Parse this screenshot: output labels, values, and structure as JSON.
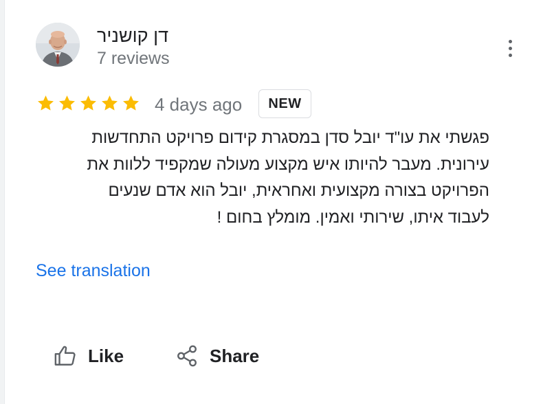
{
  "reviewer": {
    "name": "דן קושניר",
    "reviews_count": "7 reviews"
  },
  "review": {
    "rating": 5,
    "rating_max": 5,
    "star_color": "#fbbc04",
    "date": "4 days ago",
    "badge": "NEW",
    "lines": [
      "פגשתי את עו\"ד יובל סדן במסגרת קידום פרויקט התחדשות",
      "עירונית. מעבר להיותו איש מקצוע מעולה שמקפיד ללוות את",
      "הפרויקט בצורה מקצועית ואחראית, יובל הוא אדם שנעים",
      "לעבוד איתו, שירותי ואמין. מומלץ בחום !"
    ]
  },
  "see_translation_label": "See translation",
  "actions": {
    "like_label": "Like",
    "share_label": "Share"
  },
  "icons": {
    "more": "more-vert-icon",
    "like": "thumb-up-icon",
    "share": "share-icon",
    "star": "star-icon"
  },
  "colors": {
    "link": "#1a73e8",
    "secondary_text": "#70757a"
  }
}
